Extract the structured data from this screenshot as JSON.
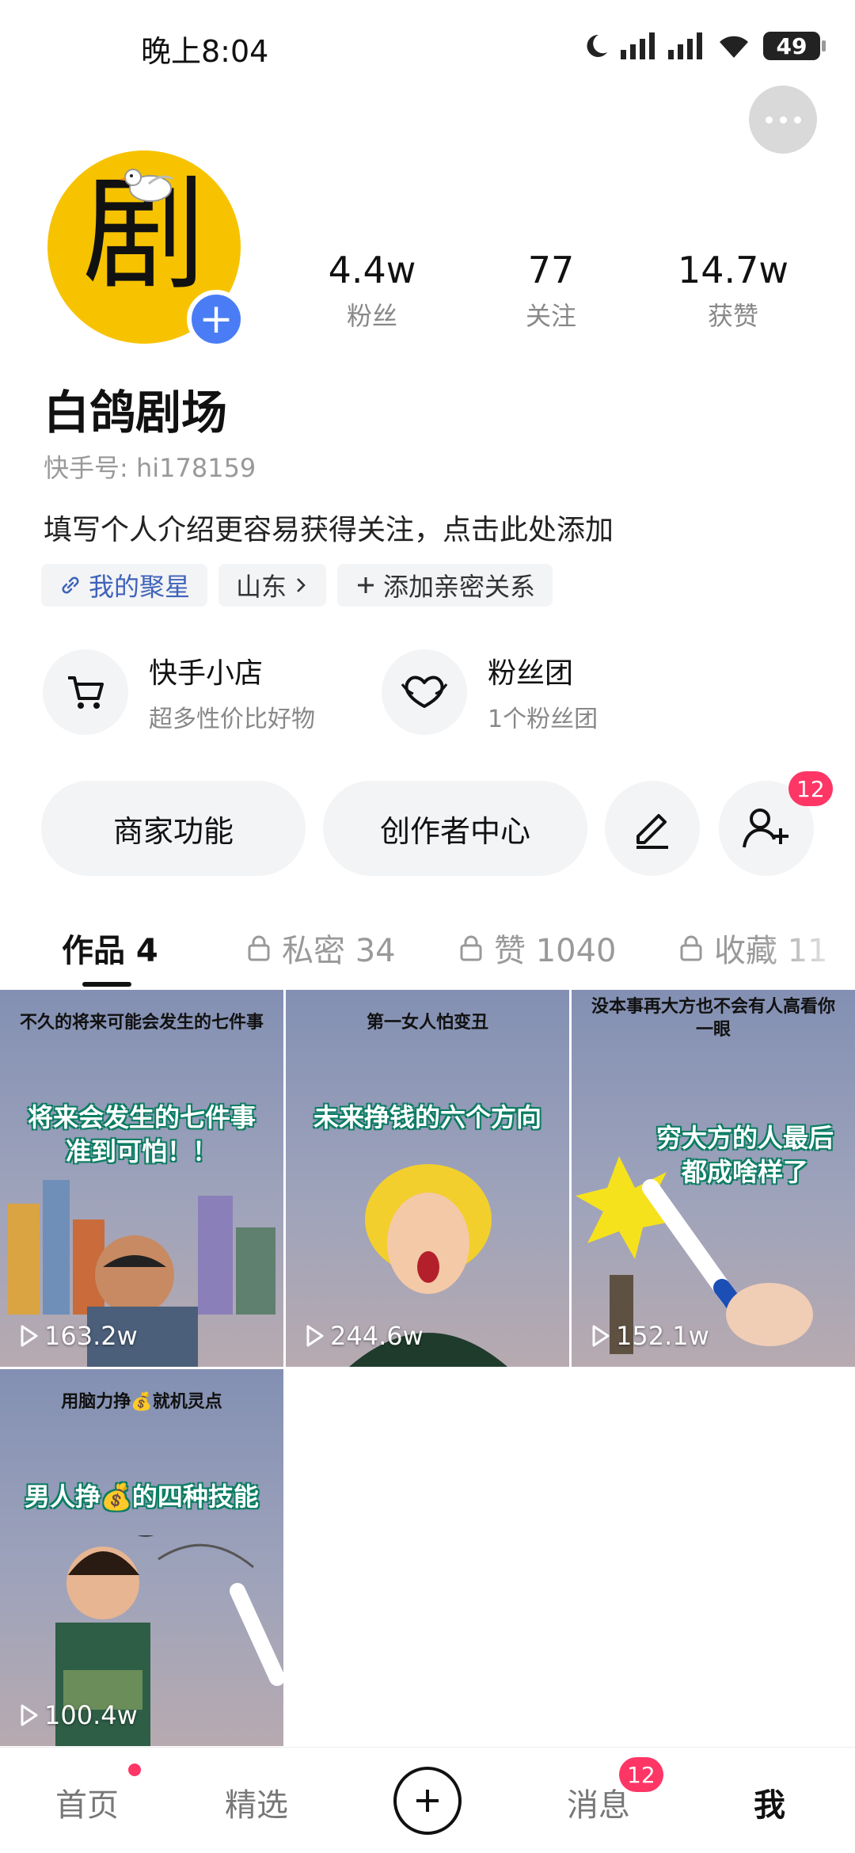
{
  "status_bar": {
    "time": "晚上8:04",
    "battery": "49"
  },
  "profile": {
    "avatar_text": "剧",
    "nickname": "白鸽剧场",
    "ks_id": "快手号: hi178159",
    "bio": "填写个人介绍更容易获得关注，点击此处添加",
    "stats": [
      {
        "value": "4.4w",
        "label": "粉丝"
      },
      {
        "value": "77",
        "label": "关注"
      },
      {
        "value": "14.7w",
        "label": "获赞"
      }
    ],
    "tags": [
      {
        "label": "我的聚星",
        "icon": "link-icon"
      },
      {
        "label": "山东",
        "icon": "chevron-right-icon"
      },
      {
        "label": "添加亲密关系",
        "icon": "plus-icon"
      }
    ]
  },
  "services": [
    {
      "title": "快手小店",
      "subtitle": "超多性价比好物",
      "icon": "cart-icon"
    },
    {
      "title": "粉丝团",
      "subtitle": "1个粉丝团",
      "icon": "heart-mask-icon"
    }
  ],
  "actions": {
    "merchant": "商家功能",
    "creator": "创作者中心",
    "friend_badge": "12"
  },
  "tabs": [
    {
      "label": "作品 4",
      "locked": false
    },
    {
      "label": "私密 34",
      "locked": true
    },
    {
      "label": "赞 1040",
      "locked": true
    },
    {
      "label": "收藏 11",
      "locked": true
    }
  ],
  "videos": [
    {
      "title": "不久的将来可能会发生的七件事",
      "cover": "将来会发生的七件事\n准到可怕！！",
      "views": "163.2w"
    },
    {
      "title": "第一女人怕变丑",
      "cover": "未来挣钱的六个方向",
      "views": "244.6w"
    },
    {
      "title": "没本事再大方也不会有人高看你一眼",
      "cover": "穷大方的人最后\n都成啥样了",
      "views": "152.1w"
    },
    {
      "title": "用脑力挣💰就机灵点",
      "cover": "男人挣💰的四种技能",
      "views": "100.4w"
    }
  ],
  "bottom_nav": {
    "home": "首页",
    "featured": "精选",
    "messages": "消息",
    "messages_badge": "12",
    "me": "我"
  },
  "colors": {
    "accent_blue": "#4a7df5",
    "badge_red": "#fe3666",
    "avatar_yellow": "#f7c300"
  }
}
